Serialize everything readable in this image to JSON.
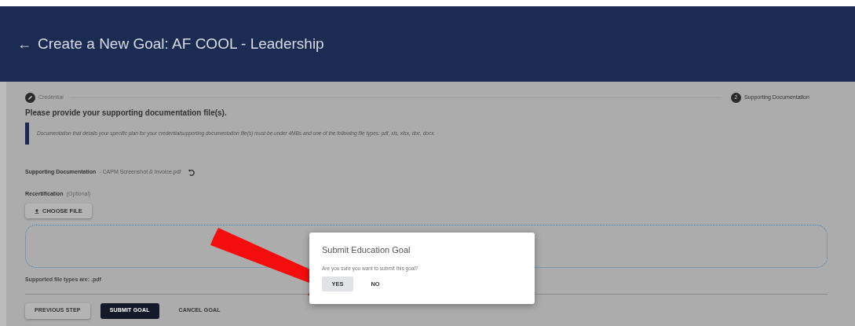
{
  "header": {
    "back": "←",
    "title": "Create a New Goal: AF COOL - Leadership"
  },
  "stepper": [
    {
      "kind": "done",
      "label": "Credential"
    },
    {
      "kind": "current",
      "number": "2",
      "label": "Supporting Documentation"
    }
  ],
  "heading": "Please provide your supporting documentation file(s).",
  "note": "Documentation that details your specific plan for your credentialsupporting documentation file(s) must be under 4MBs and one of the following file types: pdf, xls, xlsx, doc, docx.",
  "supporting": {
    "label": "Supporting Documentation",
    "value": "- CAPM Screenshot & Invoice.pdf"
  },
  "recertification": {
    "label": "Recertification",
    "hint": "(Optional)",
    "button": "CHOOSE FILE"
  },
  "supported_types": "Supported file types are: .pdf",
  "actions": [
    {
      "kind": "outline",
      "label": "PREVIOUS STEP"
    },
    {
      "kind": "filled",
      "label": "SUBMIT GOAL"
    },
    {
      "kind": "text",
      "label": "CANCEL GOAL"
    }
  ],
  "dialog": {
    "title": "Submit Education Goal",
    "message": "Are you sure you want to submit this goal?",
    "buttons": [
      {
        "label": "YES",
        "focused": true
      },
      {
        "label": "NO",
        "focused": false
      }
    ]
  }
}
